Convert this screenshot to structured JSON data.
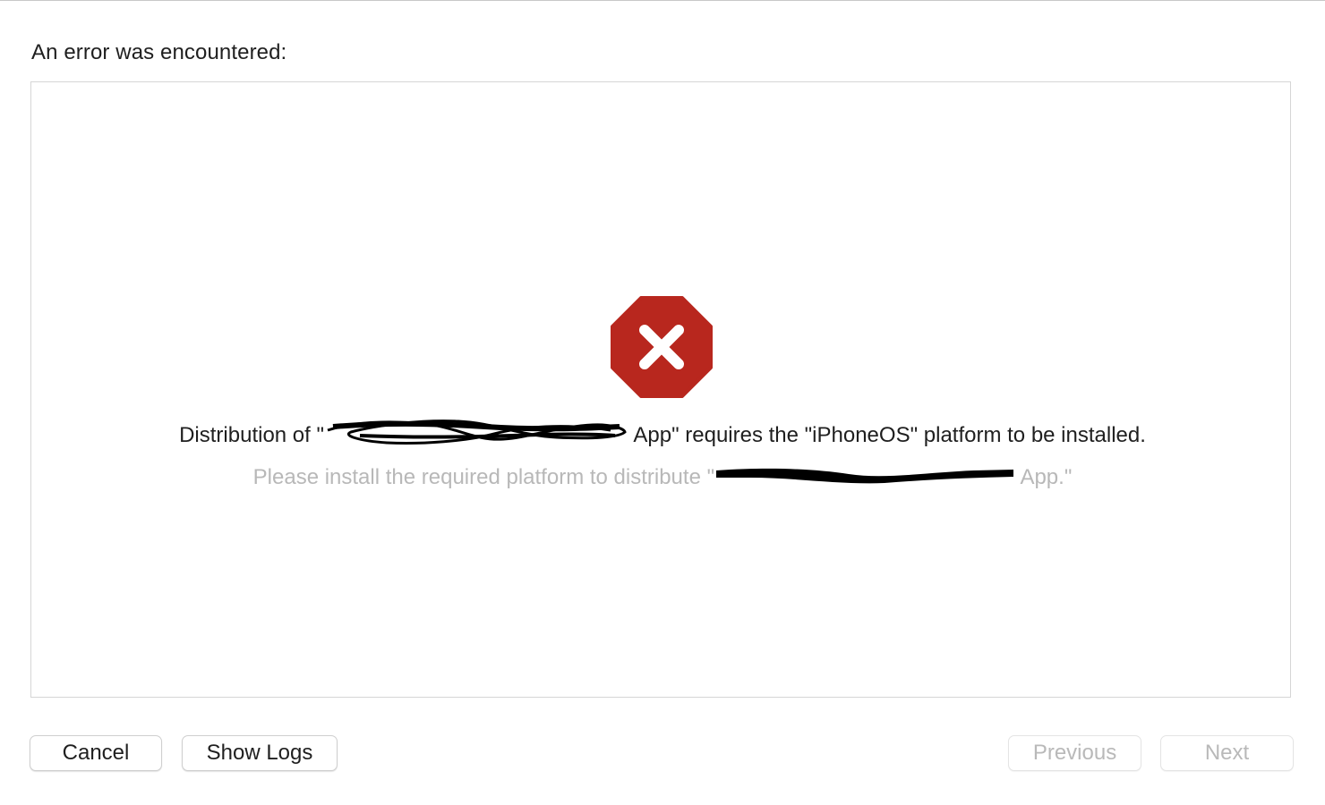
{
  "dialog": {
    "heading": "An error was encountered:"
  },
  "error": {
    "icon": "error-stop-icon",
    "icon_color": "#b8271e",
    "primary_prefix": "Distribution of \"",
    "primary_suffix": " App\" requires the \"iPhoneOS\" platform to be installed.",
    "secondary_prefix": "Please install the required platform to distribute \"",
    "secondary_suffix": " App.\""
  },
  "buttons": {
    "cancel": "Cancel",
    "show_logs": "Show Logs",
    "previous": "Previous",
    "next": "Next"
  }
}
